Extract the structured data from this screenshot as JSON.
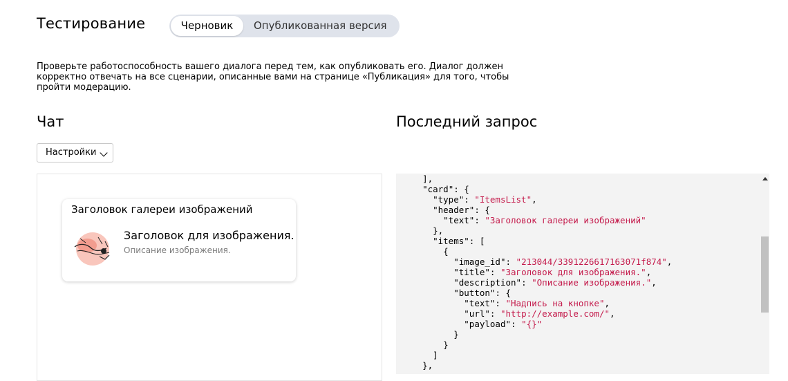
{
  "header": {
    "title": "Тестирование",
    "tabs": [
      {
        "label": "Черновик",
        "active": true
      },
      {
        "label": "Опубликованная версия",
        "active": false
      }
    ]
  },
  "description": {
    "line1": "Проверьте работоспособность вашего диалога перед тем, как опубликовать его. Диалог должен",
    "line2": "корректно отвечать на все сценарии, описанные вами на странице «Публикация» для того, чтобы",
    "line3": "пройти модерацию."
  },
  "chat": {
    "title": "Чат",
    "settings_label": "Настройки",
    "card": {
      "header": "Заголовок галереи изображений",
      "item_title": "Заголовок для изображения.",
      "item_description": "Описание изображения.",
      "thumbnail_icon": "illustration-image"
    }
  },
  "request": {
    "title": "Последний запрос",
    "code": {
      "l1": "],",
      "l2k": "\"card\"",
      "l3k": "\"type\"",
      "l3v": "\"ItemsList\"",
      "l4k": "\"header\"",
      "l5k": "\"text\"",
      "l5v": "\"Заголовок галереи изображений\"",
      "l6": "},",
      "l7k": "\"items\"",
      "l8": "{",
      "l9k": "\"image_id\"",
      "l9v": "\"213044/3391226617163071f874\"",
      "l10k": "\"title\"",
      "l10v": "\"Заголовок для изображения.\"",
      "l11k": "\"description\"",
      "l11v": "\"Описание изображения.\"",
      "l12k": "\"button\"",
      "l13k": "\"text\"",
      "l13v": "\"Надпись на кнопке\"",
      "l14k": "\"url\"",
      "l14v": "\"http://example.com/\"",
      "l15k": "\"payload\"",
      "l15v": "\"{}\"",
      "l16": "}",
      "l17": "}",
      "l18": "]",
      "l19": "},"
    }
  },
  "colors": {
    "string": "#c41a4b",
    "segment_bg": "#dfe3eb",
    "code_bg": "#f3f3f3"
  }
}
